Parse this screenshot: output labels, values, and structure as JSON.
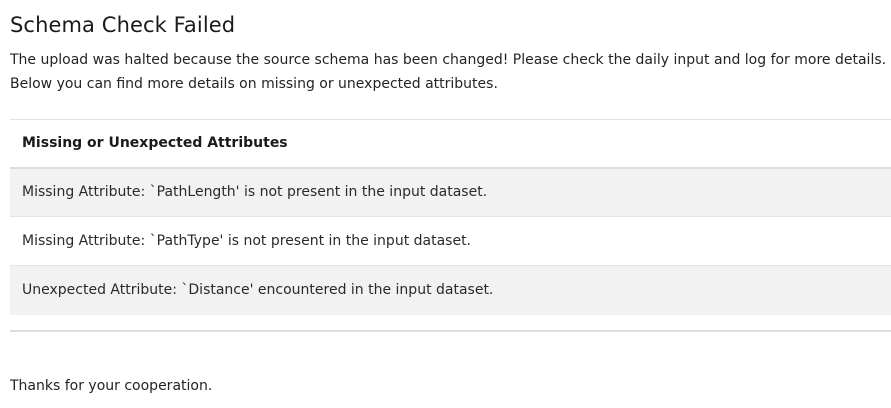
{
  "header": {
    "title": "Schema Check Failed"
  },
  "intro": {
    "line1": "The upload was halted because the source schema has been changed! Please check the daily input and log for more details.",
    "line2": "Below you can find more details on missing or unexpected attributes."
  },
  "table": {
    "column_header": "Missing or Unexpected Attributes",
    "rows": [
      "Missing Attribute: `PathLength' is not present in the input dataset.",
      "Missing Attribute: `PathType' is not present in the input dataset.",
      "Unexpected Attribute: `Distance' encountered in the input dataset."
    ]
  },
  "footer": {
    "text": "Thanks for your cooperation."
  }
}
